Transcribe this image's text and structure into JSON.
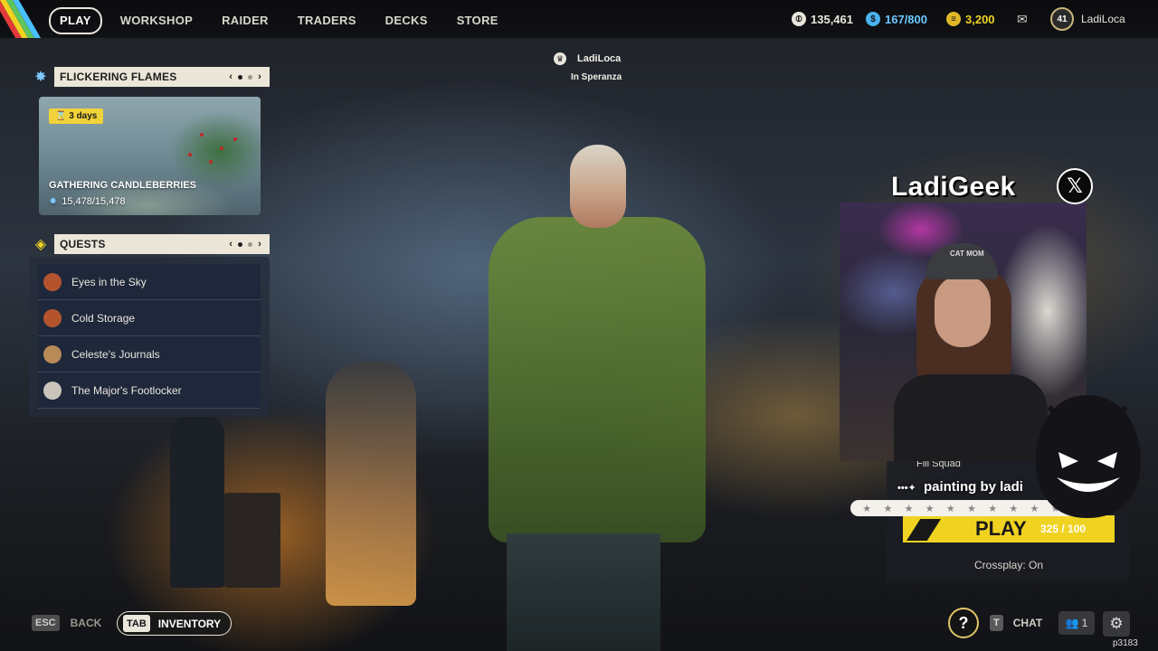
{
  "nav": {
    "items": [
      "PLAY",
      "WORKSHOP",
      "RAIDER",
      "TRADERS",
      "DECKS",
      "STORE"
    ],
    "active_index": 0
  },
  "currencies": {
    "coins": "135,461",
    "credits": "167/800",
    "tokens": "3,200"
  },
  "profile": {
    "level": "41",
    "name": "LadiLoca"
  },
  "center_player": {
    "name": "LadiLoca",
    "location": "In Speranza"
  },
  "event": {
    "header": "FLICKERING FLAMES",
    "timer": "3 days",
    "title": "GATHERING CANDLEBERRIES",
    "progress": "15,478/15,478"
  },
  "quests": {
    "header": "QUESTS",
    "items": [
      {
        "label": "Eyes in the Sky",
        "color": "#b3542e"
      },
      {
        "label": "Cold Storage",
        "color": "#b3542e"
      },
      {
        "label": "Celeste's Journals",
        "color": "#b88a58"
      },
      {
        "label": "The Major's Footlocker",
        "color": "#c9c5bc"
      }
    ]
  },
  "stream_overlay": {
    "streamer": "LadiGeek",
    "social_icon": "x-logo-icon",
    "hat_text": "CAT MOM",
    "alert_text": "painting by ladi"
  },
  "play_panel": {
    "fill_squad": "Fill Squad",
    "play_label": "PLAY",
    "count": "325 / 100",
    "crossplay": "Crossplay: On"
  },
  "bottom": {
    "esc_key": "ESC",
    "back": "BACK",
    "tab_key": "TAB",
    "inventory": "INVENTORY",
    "help": "?",
    "chat_key": "T",
    "chat": "CHAT",
    "party_count": "1",
    "build": "p3183"
  },
  "colors": {
    "accent_yellow": "#f0d321",
    "panel_cream": "#ebe6d8",
    "event_blue": "#7ec8ff"
  }
}
